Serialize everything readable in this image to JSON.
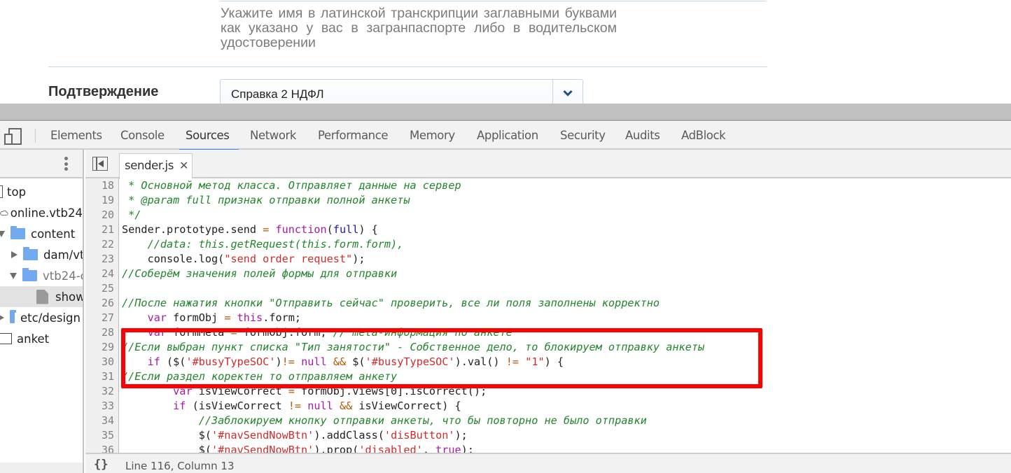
{
  "page": {
    "hint_text": "Укажите имя в латинской транскрипции заглавными буквами как указано у вас в загранпаспорте либо в водительском удостоверении",
    "confirmation_label": "Подтверждение",
    "confirmation_select": {
      "value": "Справка 2 НДФЛ",
      "icon": "chevron-down-icon"
    }
  },
  "devtools": {
    "tabs": [
      {
        "label": "Elements",
        "active": false
      },
      {
        "label": "Console",
        "active": false
      },
      {
        "label": "Sources",
        "active": true
      },
      {
        "label": "Network",
        "active": false
      },
      {
        "label": "Performance",
        "active": false
      },
      {
        "label": "Memory",
        "active": false
      },
      {
        "label": "Application",
        "active": false
      },
      {
        "label": "Security",
        "active": false
      },
      {
        "label": "Audits",
        "active": false
      },
      {
        "label": "AdBlock",
        "active": false
      }
    ],
    "navigator": {
      "items": [
        {
          "label": "top",
          "type": "frame",
          "level": 0
        },
        {
          "label": "online.vtb24",
          "type": "cloud",
          "level": 0
        },
        {
          "label": "content",
          "type": "folder",
          "level": 1,
          "expanded": true
        },
        {
          "label": "dam/vtb",
          "type": "folder",
          "level": 2,
          "expanded": false
        },
        {
          "label": "vtb24-c",
          "type": "folder",
          "level": 2,
          "expanded": true
        },
        {
          "label": "show",
          "type": "file",
          "level": 3,
          "selected": true
        },
        {
          "label": "etc/design",
          "type": "folder",
          "level": 1,
          "expanded": false
        },
        {
          "label": "anket",
          "type": "frame",
          "level": 0
        }
      ]
    },
    "editor": {
      "open_file": "sender.js",
      "highlight_color": "#ff0000",
      "line_numbers": [
        "18",
        "19",
        "20",
        "21",
        "22",
        "23",
        "24",
        "25",
        "26",
        "27",
        "28",
        "29",
        "30",
        "31",
        "32",
        "33",
        "34",
        "35",
        "36"
      ],
      "lines": [
        " * Основной метод класса. Отправляет данные на сервер",
        " * @param full признак отправки полной анкеты",
        " */",
        "Sender.prototype.send = function(full) {",
        "    //data: this.getRequest(this.form.form),",
        "    console.log(\"send order request\");",
        "//Соберём значения полей формы для отправки",
        "",
        "//После нажатия кнопки \"Отправить сейчас\" проверить, все ли поля заполнены корректно",
        "    var formObj = this.form;",
        "    var formMeta = formObj.form; // meta-информация по анкете",
        "//Если выбран пункт списка \"Тип занятости\" - Собственное дело, то блокируем отправку анкеты",
        "    if ($('#busyTypeSOC')!= null && $('#busyTypeSOC').val() != \"1\") {",
        "//Если раздел коректен то отправляем анкету",
        "        var isViewCorrect = formObj.views[0].isCorrect();",
        "        if (isViewCorrect != null && isViewCorrect) {",
        "            //Заблокируем кнопку отправки анкеты, что бы повторно не было отправки",
        "            $('#navSendNowBtn').addClass('disButton');",
        "            $('#navSendNowBtn').prop('disabled', true);"
      ]
    },
    "status": {
      "cursor_position": "Line 116, Column 13",
      "format_icon": "{}"
    }
  }
}
